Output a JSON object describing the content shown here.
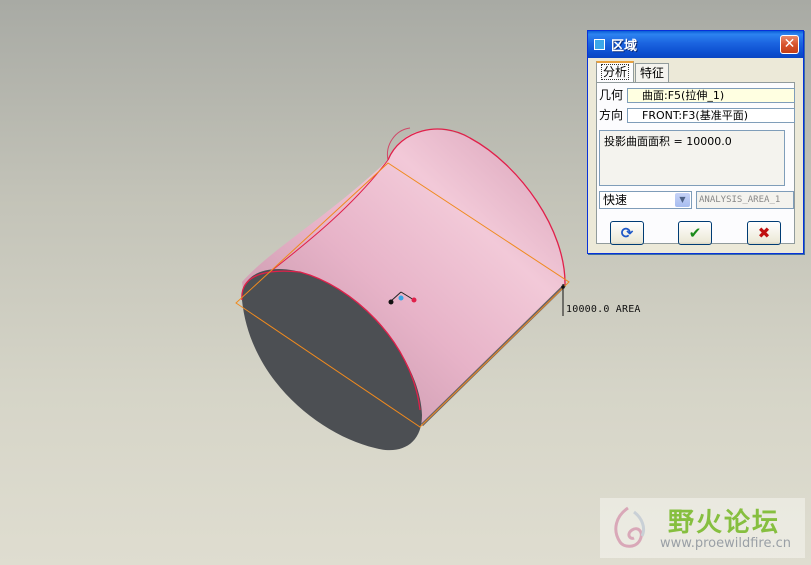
{
  "viewport": {
    "area_annotation": "10000.0 AREA"
  },
  "dialog": {
    "title": "区域",
    "close_label": "✕",
    "tabs": [
      {
        "label": "分析",
        "active": true
      },
      {
        "label": "特征",
        "active": false
      }
    ],
    "geometry_label": "几何",
    "geometry_value": "曲面:F5(拉伸_1)",
    "direction_label": "方向",
    "direction_value": "FRONT:F3(基准平面)",
    "result_text": "投影曲面面积 = 10000.0",
    "mode_select": {
      "selected": "快速"
    },
    "analysis_name": "ANALYSIS_AREA_1",
    "buttons": {
      "repeat_icon": "refresh-icon",
      "ok_icon": "checkmark-icon",
      "cancel_icon": "x-icon"
    }
  },
  "watermark": {
    "title": "野火论坛",
    "url": "www.proewildfire.cn"
  },
  "colors": {
    "cylinder_side": "#e8b0c6",
    "cylinder_cap": "#4c4f53",
    "edge": "#e0204a",
    "projection_box": "#f08a1e",
    "dialog_title": "#0a55d6"
  }
}
